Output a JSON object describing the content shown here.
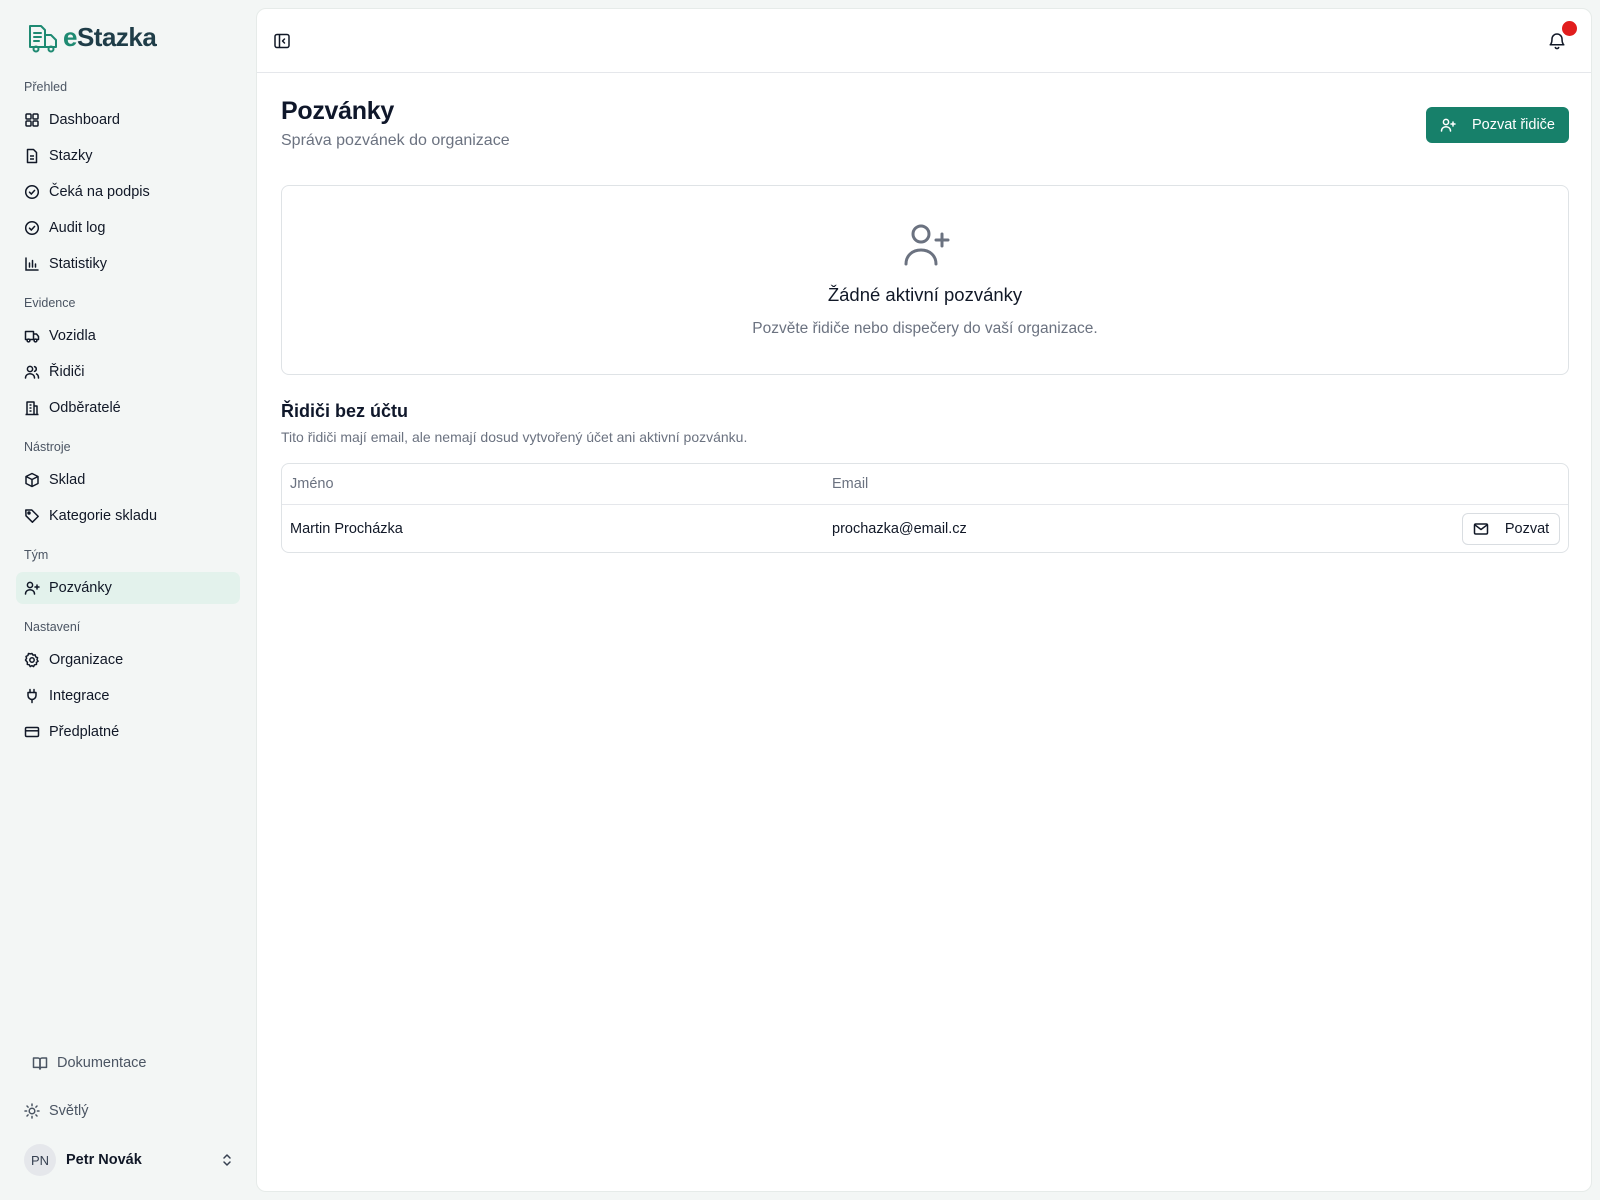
{
  "app": {
    "logo_prefix": "e",
    "logo_name": "Stazka",
    "brand_color": "#17806a"
  },
  "sidebar": {
    "sections": [
      {
        "label": "Přehled",
        "items": [
          {
            "label": "Dashboard",
            "icon": "grid-icon"
          },
          {
            "label": "Stazky",
            "icon": "document-icon"
          },
          {
            "label": "Čeká na podpis",
            "icon": "check-circle-icon"
          },
          {
            "label": "Audit log",
            "icon": "check-circle-icon"
          },
          {
            "label": "Statistiky",
            "icon": "bar-chart-icon"
          }
        ]
      },
      {
        "label": "Evidence",
        "items": [
          {
            "label": "Vozidla",
            "icon": "truck-icon"
          },
          {
            "label": "Řidiči",
            "icon": "users-icon"
          },
          {
            "label": "Odběratelé",
            "icon": "building-icon"
          }
        ]
      },
      {
        "label": "Nástroje",
        "items": [
          {
            "label": "Sklad",
            "icon": "box-icon"
          },
          {
            "label": "Kategorie skladu",
            "icon": "tag-icon"
          }
        ]
      },
      {
        "label": "Tým",
        "items": [
          {
            "label": "Pozvánky",
            "icon": "user-plus-icon",
            "active": true
          }
        ]
      },
      {
        "label": "Nastavení",
        "items": [
          {
            "label": "Organizace",
            "icon": "gear-icon"
          },
          {
            "label": "Integrace",
            "icon": "plug-icon"
          },
          {
            "label": "Předplatné",
            "icon": "credit-card-icon"
          }
        ]
      }
    ],
    "docs_label": "Dokumentace",
    "theme_label": "Světlý",
    "user": {
      "initials": "PN",
      "name": "Petr Novák"
    }
  },
  "header": {
    "notification_color": "#e11d1d"
  },
  "main": {
    "title": "Pozvánky",
    "subtitle": "Správa pozvánek do organizace",
    "invite_button_label": "Pozvat řidiče",
    "empty_state": {
      "title": "Žádné aktivní pozvánky",
      "text": "Pozvěte řidiče nebo dispečery do vaší organizace."
    },
    "drivers_section": {
      "title": "Řidiči bez účtu",
      "subtitle": "Tito řidiči mají email, ale nemají dosud vytvořený účet ani aktivní pozvánku.",
      "columns": [
        "Jméno",
        "Email"
      ],
      "rows": [
        {
          "name": "Martin Procházka",
          "email": "prochazka@email.cz",
          "action_label": "Pozvat"
        }
      ]
    }
  }
}
